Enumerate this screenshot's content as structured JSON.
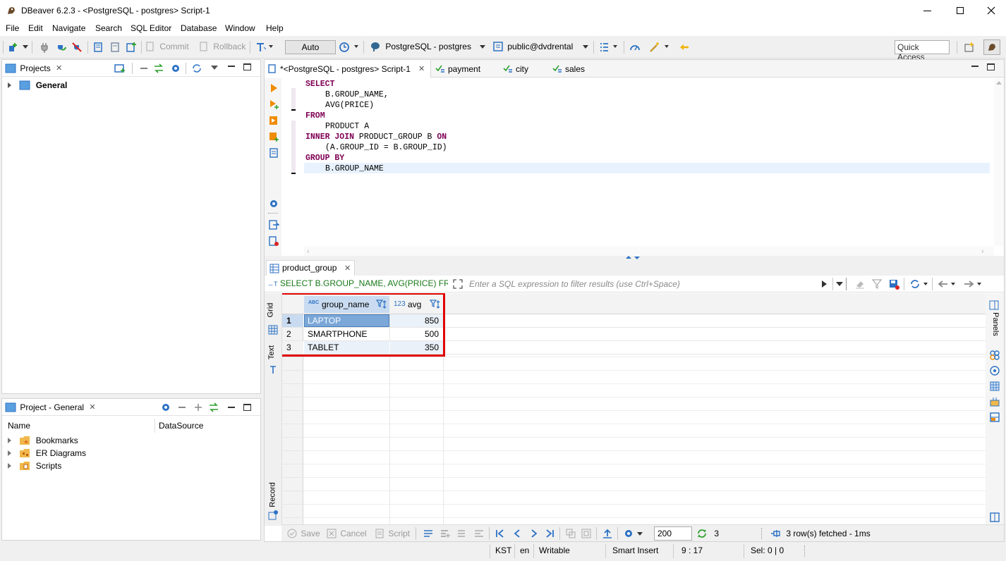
{
  "window": {
    "title": "DBeaver 6.2.3 - <PostgreSQL - postgres> Script-1"
  },
  "menu": [
    "File",
    "Edit",
    "Navigate",
    "Search",
    "SQL Editor",
    "Database",
    "Window",
    "Help"
  ],
  "toolbar": {
    "commit_label": "Commit",
    "rollback_label": "Rollback",
    "auto_label": "Auto",
    "connection_label": "PostgreSQL - postgres",
    "schema_label": "public@dvdrental",
    "quick_access_placeholder": "Quick Access"
  },
  "projects_panel": {
    "title": "Projects",
    "root": "General"
  },
  "project_general_panel": {
    "title": "Project - General",
    "col_name": "Name",
    "col_datasource": "DataSource",
    "items": [
      "Bookmarks",
      "ER Diagrams",
      "Scripts"
    ]
  },
  "editor_tabs": [
    "*<PostgreSQL - postgres> Script-1",
    "payment",
    "city",
    "sales"
  ],
  "sql": {
    "l1": "SELECT",
    "l2": "B.GROUP_NAME,",
    "l3": "AVG(PRICE)",
    "l4": "FROM",
    "l5": "PRODUCT A",
    "l6a": "INNER JOIN",
    "l6b": " PRODUCT_GROUP B ",
    "l6c": "ON",
    "l7": "(A.GROUP_ID = B.GROUP_ID)",
    "l8": "GROUP BY",
    "l9": "B.GROUP_NAME"
  },
  "results": {
    "tab_label": "product_group",
    "query_text": "SELECT B.GROUP_NAME, AVG(PRICE) FRON",
    "filter_placeholder": "Enter a SQL expression to filter results (use Ctrl+Space)",
    "side_grid": "Grid",
    "side_text": "Text",
    "side_record": "Record",
    "side_panels": "Panels",
    "col1_type": "ABC",
    "col1_name": "group_name",
    "col2_type": "123",
    "col2_name": "avg",
    "rows": [
      {
        "num": "1",
        "name": "LAPTOP",
        "avg": "850"
      },
      {
        "num": "2",
        "name": "SMARTPHONE",
        "avg": "500"
      },
      {
        "num": "3",
        "name": "TABLET",
        "avg": "350"
      }
    ],
    "bottom": {
      "save": "Save",
      "cancel": "Cancel",
      "script": "Script",
      "fetch_size": "200",
      "refresh_count": "3",
      "status": "3 row(s) fetched - 1ms"
    }
  },
  "statusbar": {
    "tz": "KST",
    "lang": "en",
    "mode": "Writable",
    "insert": "Smart Insert",
    "pos": "9 : 17",
    "sel": "Sel: 0 | 0"
  },
  "colors": {
    "accent": "#1e6fc8",
    "highlight_box": "#e00000",
    "keyword": "#7f0055",
    "selected_cell": "#7ba7d9"
  }
}
